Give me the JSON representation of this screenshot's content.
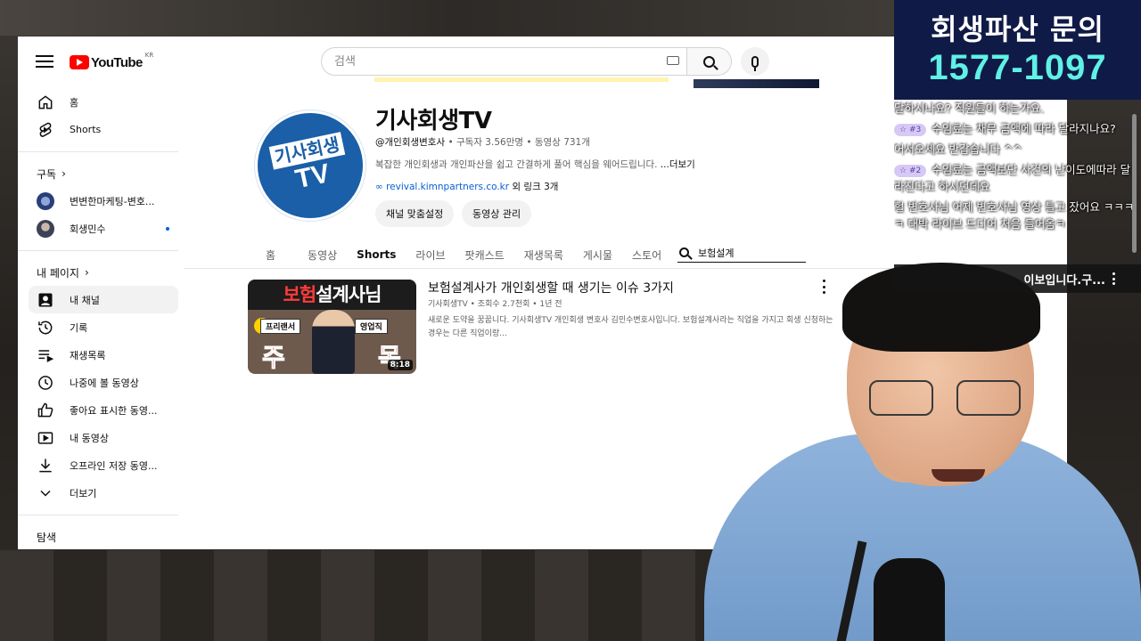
{
  "masthead": {
    "logo_text": "YouTube",
    "logo_region": "KR",
    "search_placeholder": "검색"
  },
  "sidebar": {
    "top_items": [
      {
        "label": "홈",
        "icon": "home-icon"
      },
      {
        "label": "Shorts",
        "icon": "shorts-icon"
      }
    ],
    "subscriptions_header": "구독",
    "subscriptions": [
      {
        "label": "변변한마케팅-변호..."
      },
      {
        "label": "회생민수"
      }
    ],
    "my_page_header": "내 페이지",
    "my_page_items": [
      {
        "label": "내 채널",
        "icon": "account-box-icon",
        "active": true
      },
      {
        "label": "기록",
        "icon": "history-icon"
      },
      {
        "label": "재생목록",
        "icon": "playlist-icon"
      },
      {
        "label": "나중에 볼 동영상",
        "icon": "clock-icon"
      },
      {
        "label": "좋아요 표시한 동영...",
        "icon": "thumbs-up-icon"
      },
      {
        "label": "내 동영상",
        "icon": "video-icon"
      },
      {
        "label": "오프라인 저장 동영...",
        "icon": "download-icon"
      },
      {
        "label": "더보기",
        "icon": "chevron-down-icon"
      }
    ],
    "explore_header": "탐색"
  },
  "channel": {
    "avatar_line1": "기사회생",
    "avatar_line2": "TV",
    "name": "기사회생TV",
    "handle": "@개인회생변호사",
    "stats": " • 구독자 3.56만명 • 동영상 731개",
    "description": "복잡한 개인회생과 개인파산을 쉽고 간결하게 풀어 핵심을 웨어드립니다. ",
    "more_label": "...더보기",
    "link_url": "revival.kimnpartners.co.kr",
    "link_extra": " 외 링크 3개",
    "buttons": [
      "채널 맞춤설정",
      "동영상 관리"
    ]
  },
  "tabs": {
    "items": [
      "홈",
      "동영상",
      "Shorts",
      "라이브",
      "팟캐스트",
      "재생목록",
      "게시물",
      "스토어"
    ],
    "active_index": 2,
    "search_value": "보험설계"
  },
  "video": {
    "thumb_title_a": "보험",
    "thumb_title_b": "설계사님",
    "thumb_tag1": "프리랜서",
    "thumb_tag2": "영업직",
    "thumb_big1": "주",
    "thumb_big2": "목",
    "duration": "8:18",
    "title": "보험설계사가 개인회생할 때 생기는 이슈 3가지",
    "meta": "기사회생TV • 조회수 2.7천회 • 1년 전",
    "description": "새로운 도약을 꿈꿉니다. 기사회생TV 개인회생 변호사 김민수변호사입니다. 보험설계사라는 직업을 가지고 회생 신청하는 경우는 다른 직업이랑..."
  },
  "overlay": {
    "banner_line1": "회생파산 문의",
    "banner_line2": "1577-1097",
    "chat_messages": [
      {
        "badge": "",
        "text": "달하시나요? 직원들이 하는가요."
      },
      {
        "badge": "#3",
        "text": "수임료는 채무 금액에 따라 달라지나요?"
      },
      {
        "badge": "",
        "text": "어서오세요 반갑습니다 ^^"
      },
      {
        "badge": "#2",
        "text": "수임료는 금액보단 사건의 난이도에따라 달라진다고 하시던데요"
      },
      {
        "badge": "",
        "text": "헐 변호사님 어제 변호사님 영상 틀고 잤어요 ㅋㅋㅋㅋ 대박 라이브 드디어 처음 들어옴ㅋ"
      }
    ],
    "pinned_text": "이보입니다.구..."
  },
  "colors": {
    "brand_red": "#ff0000",
    "link_blue": "#065fd4",
    "banner_bg": "#0f1a46",
    "banner_accent": "#5ff1e6",
    "channel_blue": "#1a5fa8"
  }
}
